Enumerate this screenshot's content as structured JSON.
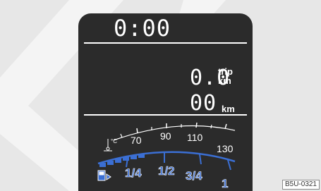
{
  "display": {
    "clock": "0:00",
    "trip_value": "0.0",
    "trip_unit_top": "trip",
    "trip_unit_bottom": "km",
    "odometer_value": "00",
    "odometer_unit": "km"
  },
  "speed_scale": {
    "labels": [
      "70",
      "90",
      "110",
      "130"
    ],
    "temp_unit": "°C"
  },
  "fuel_scale": {
    "labels": [
      "1/4",
      "1/2",
      "3/4",
      "1"
    ],
    "level_fraction": 0.2
  },
  "reference": "B5U-0321",
  "colors": {
    "display_bg": "#2b2b2b",
    "fuel_blue": "#3b6fd4",
    "text": "#ffffff",
    "backdrop": "#e7e7e7",
    "chevron": "#f4f4f4"
  }
}
